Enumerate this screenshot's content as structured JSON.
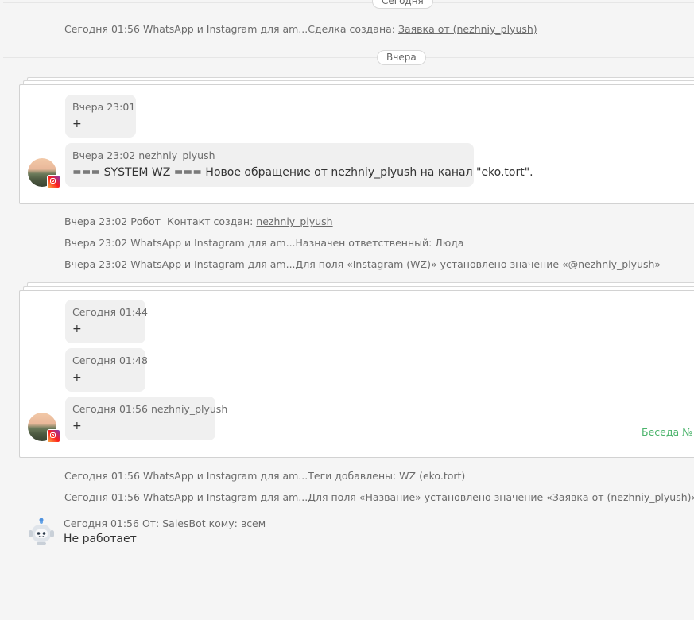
{
  "day_labels": {
    "today": "Сегодня",
    "yesterday": "Вчера"
  },
  "top_event": {
    "time": "Сегодня 01:56",
    "source": "WhatsApp и Instagram для am...",
    "action": "Сделка создана:",
    "link": "Заявка от (nezhniy_plyush)"
  },
  "conversation1": {
    "messages": [
      {
        "meta": "Вчера 23:01",
        "text": "+"
      },
      {
        "meta": "Вчера 23:02 nezhniy_plyush",
        "text": "=== SYSTEM WZ === Новое обращение от nezhniy_plyush на канал \"eko.tort\"."
      }
    ],
    "avatar_icon": "instagram-icon"
  },
  "events_middle": [
    {
      "time": "Вчера 23:02",
      "source": "Робот",
      "action": "Контакт создан:",
      "link": "nezhniy_plyush"
    },
    {
      "time": "Вчера 23:02",
      "source": "WhatsApp и Instagram для am...",
      "action": "Назначен ответственный: Люда"
    },
    {
      "time": "Вчера 23:02",
      "source": "WhatsApp и Instagram для am...",
      "action": "Для поля «Instagram (WZ)» установлено значение «@nezhniy_plyush»"
    }
  ],
  "conversation2": {
    "messages": [
      {
        "meta": "Сегодня 01:44",
        "text": "+"
      },
      {
        "meta": "Сегодня 01:48",
        "text": "+"
      },
      {
        "meta": "Сегодня 01:56 nezhniy_plyush",
        "text": "+"
      }
    ],
    "conversation_link": "Беседа № А",
    "avatar_icon": "instagram-icon"
  },
  "events_bottom": [
    {
      "time": "Сегодня 01:56",
      "source": "WhatsApp и Instagram для am...",
      "action": "Теги добавлены: WZ (eko.tort)"
    },
    {
      "time": "Сегодня 01:56",
      "source": "WhatsApp и Instagram для am...",
      "action": "Для поля «Название» установлено значение «Заявка от (nezhniy_plyush)»"
    }
  ],
  "salesbot": {
    "meta": "Сегодня 01:56 От: SalesBot кому: всем",
    "text": "Не работает",
    "icon": "robot-icon"
  },
  "colors": {
    "background": "#f5f5f5",
    "bubble": "#f0f0f0",
    "link_green": "#4cb46c"
  }
}
